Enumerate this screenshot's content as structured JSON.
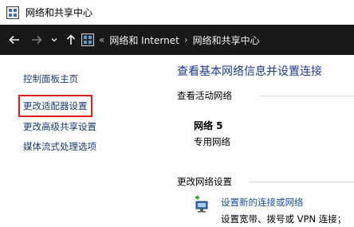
{
  "window": {
    "title": "网络和共享中心"
  },
  "address": {
    "breadcrumbs": [
      "网络和 Internet",
      "网络和共享中心"
    ],
    "overflow": "«",
    "separator": "›"
  },
  "sidebar": {
    "items": [
      {
        "label": "控制面板主页"
      },
      {
        "label": "更改适配器设置",
        "highlighted": true
      },
      {
        "label": "更改高级共享设置"
      },
      {
        "label": "媒体流式处理选项"
      }
    ]
  },
  "main": {
    "heading": "查看基本网络信息并设置连接",
    "active_networks_label": "查看活动网络",
    "network": {
      "name": "网络 5",
      "type": "专用网络"
    },
    "change_settings_label": "更改网络设置",
    "setup": {
      "link": "设置新的连接或网络",
      "description": "设置宽带、拨号或 VPN 连接；"
    }
  },
  "colors": {
    "highlight": "#e01b1b",
    "link": "#1a4fa0",
    "addressbar": "#191919"
  }
}
